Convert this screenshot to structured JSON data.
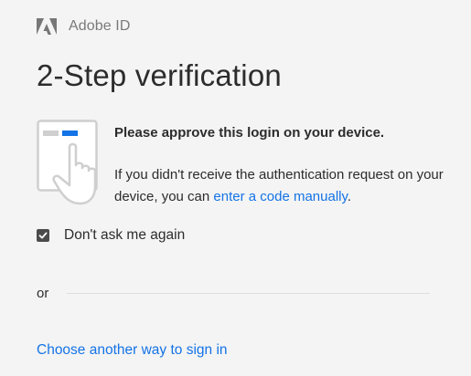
{
  "header": {
    "brand": "Adobe ID",
    "logo_icon": "adobe-logo-icon"
  },
  "title": "2-Step verification",
  "approval": {
    "heading": "Please approve this login on your device.",
    "body_prefix": "If you didn't receive the authentication request on your device, you can ",
    "manual_link": "enter a code manually",
    "body_suffix": ".",
    "illustration_icon": "tap-phone-icon"
  },
  "remember": {
    "label": "Don't ask me again",
    "checked": true
  },
  "separator": {
    "label": "or"
  },
  "alternate": {
    "link": "Choose another way to sign in"
  },
  "colors": {
    "background": "#f4f4f4",
    "link": "#1473e6",
    "text": "#2c2c2c",
    "muted": "#7a7a7a"
  }
}
